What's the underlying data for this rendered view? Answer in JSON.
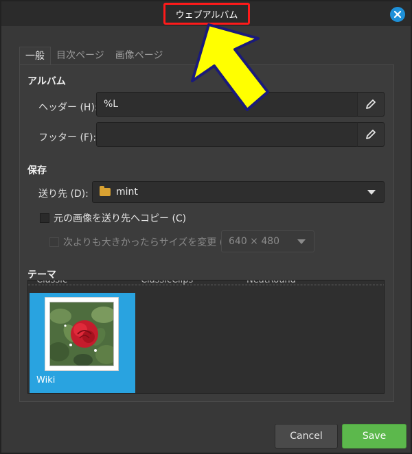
{
  "window": {
    "title": "ウェブアルバム"
  },
  "tabs": [
    {
      "label": "一般"
    },
    {
      "label": "目次ページ"
    },
    {
      "label": "画像ページ"
    }
  ],
  "album": {
    "heading": "アルバム",
    "header_label": "ヘッダー (H):",
    "header_value": "%L",
    "footer_label": "フッター (F):",
    "footer_value": ""
  },
  "save_section": {
    "heading": "保存",
    "dest_label": "送り先 (D):",
    "dest_value": "mint",
    "copy_label": "元の画像を送り先へコピー (C)",
    "resize_label": "次よりも大きかったらサイズを変更 (R):",
    "resize_value": "640 × 480"
  },
  "theme": {
    "heading": "テーマ",
    "names_top": [
      "Classic",
      "ClassicClips",
      "NeatRound"
    ],
    "selected": "Wiki"
  },
  "buttons": {
    "cancel": "Cancel",
    "save": "Save"
  },
  "colors": {
    "accent": "#29a3e0",
    "save": "#5cb84c",
    "highlight": "#ff1a1a",
    "annotation": "#ffff00"
  }
}
